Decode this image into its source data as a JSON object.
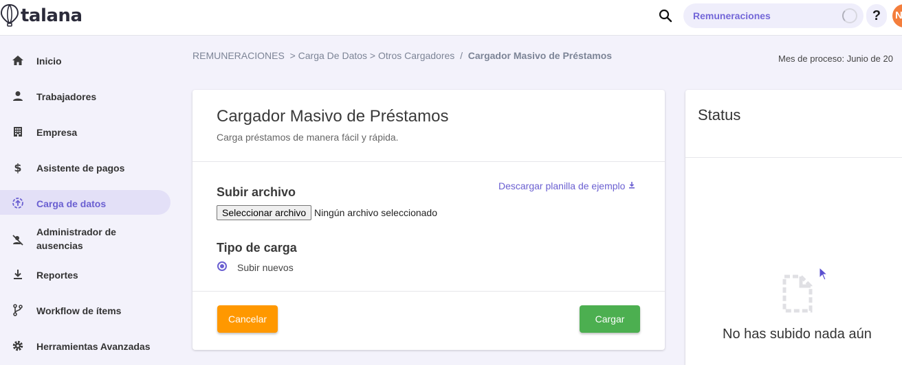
{
  "app": {
    "logo_text": "talana",
    "module_selector": "Remuneraciones",
    "help_label": "?",
    "avatar_initial": "N"
  },
  "sidebar": {
    "items": [
      {
        "label": "Inicio",
        "icon": "home-icon"
      },
      {
        "label": "Trabajadores",
        "icon": "person-icon"
      },
      {
        "label": "Empresa",
        "icon": "building-icon"
      },
      {
        "label": "Asistente de pagos",
        "icon": "dollar-icon"
      },
      {
        "label": "Carga de datos",
        "icon": "upload-circle-icon",
        "active": true
      },
      {
        "label": "Administrador de ausencias",
        "icon": "person-off-icon"
      },
      {
        "label": "Reportes",
        "icon": "download-icon"
      },
      {
        "label": "Workflow de ítems",
        "icon": "branch-icon"
      },
      {
        "label": "Herramientas Avanzadas",
        "icon": "gear-icon"
      }
    ]
  },
  "breadcrumb": {
    "items": [
      "REMUNERACIONES",
      "Carga De Datos",
      "Otros Cargadores"
    ],
    "current": "Cargador Masivo de Préstamos"
  },
  "process_month": "Mes de proceso: Junio de 20",
  "loader": {
    "title": "Cargador Masivo de Préstamos",
    "subtitle": "Carga préstamos de manera fácil y rápida.",
    "upload_title": "Subir archivo",
    "download_link": "Descargar planilla de ejemplo",
    "file_button": "Seleccionar archivo",
    "file_status": "Ningún archivo seleccionado",
    "type_title": "Tipo de carga",
    "option_new": "Subir nuevos",
    "cancel_button": "Cancelar",
    "submit_button": "Cargar"
  },
  "status": {
    "title": "Status",
    "empty_text": "No has subido nada aún"
  },
  "colors": {
    "accent": "#6a5fd1",
    "cancel": "#ff9800",
    "submit": "#4caf50",
    "avatar": "#f47e3c"
  }
}
